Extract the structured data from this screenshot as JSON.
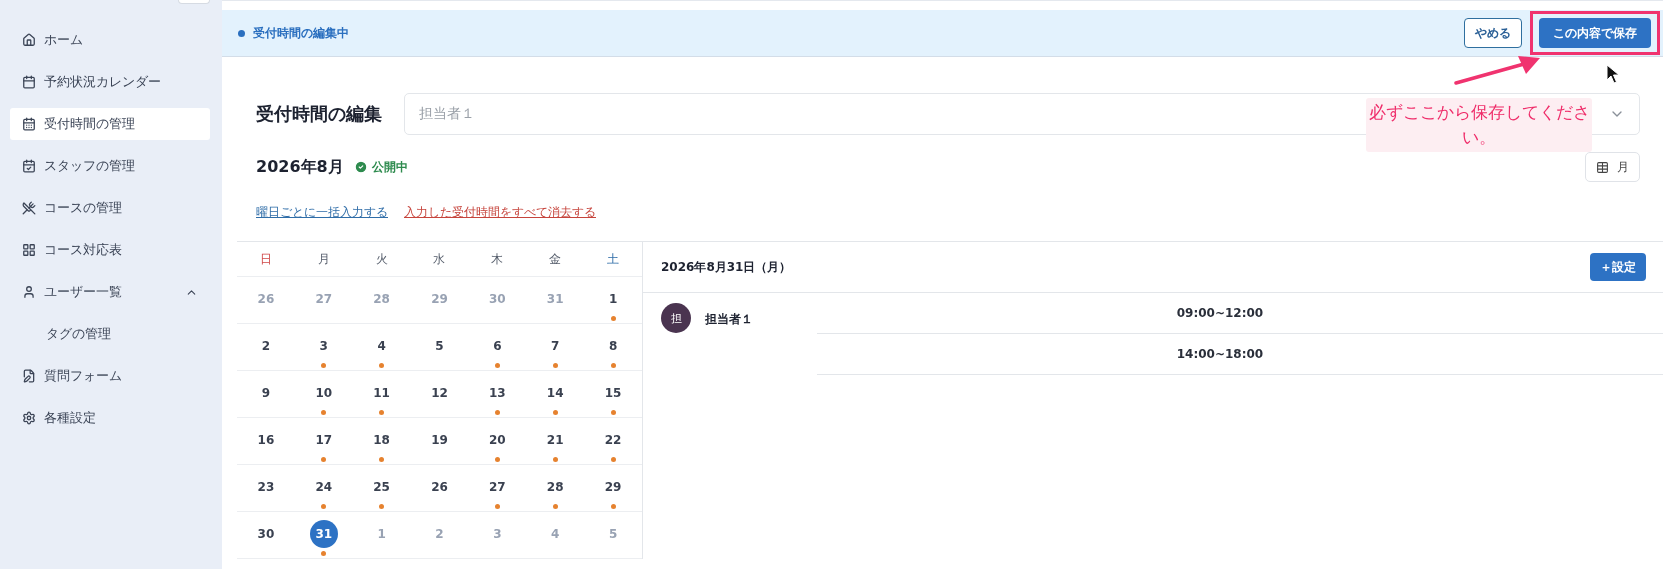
{
  "sidebar": {
    "items": [
      {
        "label": "ホーム",
        "selected": false
      },
      {
        "label": "予約状況カレンダー",
        "selected": false
      },
      {
        "label": "受付時間の管理",
        "selected": true
      },
      {
        "label": "スタッフの管理",
        "selected": false
      },
      {
        "label": "コースの管理",
        "selected": false
      },
      {
        "label": "コース対応表",
        "selected": false
      },
      {
        "label": "ユーザー一覧",
        "selected": false,
        "expanded": true,
        "children": [
          {
            "label": "タグの管理",
            "selected": false
          }
        ]
      },
      {
        "label": "質問フォーム",
        "selected": false
      },
      {
        "label": "各種設定",
        "selected": false
      }
    ]
  },
  "banner": {
    "status": "受付時間の編集中",
    "buttons": [
      {
        "label": "やめる",
        "kind": "outline",
        "highlighted": false
      },
      {
        "label": "この内容で保存",
        "kind": "primary",
        "highlighted": true
      }
    ]
  },
  "annotation": {
    "text": "必ずここから保存してください。"
  },
  "title": "受付時間の編集",
  "staff_select": {
    "value": "担当者１"
  },
  "month": {
    "label": "2026年8月",
    "status": "公開中",
    "published": true
  },
  "view_button": "月",
  "links": [
    {
      "label": "曜日ごとに一括入力する",
      "kind": "bulk"
    },
    {
      "label": "入力した受付時間をすべて消去する",
      "kind": "clear"
    }
  ],
  "calendar": {
    "weekdays": [
      "日",
      "月",
      "火",
      "水",
      "木",
      "金",
      "土"
    ],
    "weeks": [
      [
        {
          "day": "26",
          "in_month": false,
          "has_slots": false,
          "selected": false
        },
        {
          "day": "27",
          "in_month": false,
          "has_slots": false,
          "selected": false
        },
        {
          "day": "28",
          "in_month": false,
          "has_slots": false,
          "selected": false
        },
        {
          "day": "29",
          "in_month": false,
          "has_slots": false,
          "selected": false
        },
        {
          "day": "30",
          "in_month": false,
          "has_slots": false,
          "selected": false
        },
        {
          "day": "31",
          "in_month": false,
          "has_slots": false,
          "selected": false
        },
        {
          "day": "1",
          "in_month": true,
          "has_slots": true,
          "selected": false
        }
      ],
      [
        {
          "day": "2",
          "in_month": true,
          "has_slots": false,
          "selected": false
        },
        {
          "day": "3",
          "in_month": true,
          "has_slots": true,
          "selected": false
        },
        {
          "day": "4",
          "in_month": true,
          "has_slots": true,
          "selected": false
        },
        {
          "day": "5",
          "in_month": true,
          "has_slots": false,
          "selected": false
        },
        {
          "day": "6",
          "in_month": true,
          "has_slots": true,
          "selected": false
        },
        {
          "day": "7",
          "in_month": true,
          "has_slots": true,
          "selected": false
        },
        {
          "day": "8",
          "in_month": true,
          "has_slots": true,
          "selected": false
        }
      ],
      [
        {
          "day": "9",
          "in_month": true,
          "has_slots": false,
          "selected": false
        },
        {
          "day": "10",
          "in_month": true,
          "has_slots": true,
          "selected": false
        },
        {
          "day": "11",
          "in_month": true,
          "has_slots": true,
          "selected": false
        },
        {
          "day": "12",
          "in_month": true,
          "has_slots": false,
          "selected": false
        },
        {
          "day": "13",
          "in_month": true,
          "has_slots": true,
          "selected": false
        },
        {
          "day": "14",
          "in_month": true,
          "has_slots": true,
          "selected": false
        },
        {
          "day": "15",
          "in_month": true,
          "has_slots": true,
          "selected": false
        }
      ],
      [
        {
          "day": "16",
          "in_month": true,
          "has_slots": false,
          "selected": false
        },
        {
          "day": "17",
          "in_month": true,
          "has_slots": true,
          "selected": false
        },
        {
          "day": "18",
          "in_month": true,
          "has_slots": true,
          "selected": false
        },
        {
          "day": "19",
          "in_month": true,
          "has_slots": false,
          "selected": false
        },
        {
          "day": "20",
          "in_month": true,
          "has_slots": true,
          "selected": false
        },
        {
          "day": "21",
          "in_month": true,
          "has_slots": true,
          "selected": false
        },
        {
          "day": "22",
          "in_month": true,
          "has_slots": true,
          "selected": false
        }
      ],
      [
        {
          "day": "23",
          "in_month": true,
          "has_slots": false,
          "selected": false
        },
        {
          "day": "24",
          "in_month": true,
          "has_slots": true,
          "selected": false
        },
        {
          "day": "25",
          "in_month": true,
          "has_slots": true,
          "selected": false
        },
        {
          "day": "26",
          "in_month": true,
          "has_slots": false,
          "selected": false
        },
        {
          "day": "27",
          "in_month": true,
          "has_slots": true,
          "selected": false
        },
        {
          "day": "28",
          "in_month": true,
          "has_slots": true,
          "selected": false
        },
        {
          "day": "29",
          "in_month": true,
          "has_slots": true,
          "selected": false
        }
      ],
      [
        {
          "day": "30",
          "in_month": true,
          "has_slots": false,
          "selected": false
        },
        {
          "day": "31",
          "in_month": true,
          "has_slots": true,
          "selected": true
        },
        {
          "day": "1",
          "in_month": false,
          "has_slots": false,
          "selected": false
        },
        {
          "day": "2",
          "in_month": false,
          "has_slots": false,
          "selected": false
        },
        {
          "day": "3",
          "in_month": false,
          "has_slots": false,
          "selected": false
        },
        {
          "day": "4",
          "in_month": false,
          "has_slots": false,
          "selected": false
        },
        {
          "day": "5",
          "in_month": false,
          "has_slots": false,
          "selected": false
        }
      ]
    ]
  },
  "detail": {
    "date": "2026年8月31日（月）",
    "add_button": "＋設定",
    "staff": [
      {
        "avatar": "担",
        "name": "担当者１",
        "slots": [
          "09:00~12:00",
          "14:00~18:00"
        ]
      }
    ]
  }
}
